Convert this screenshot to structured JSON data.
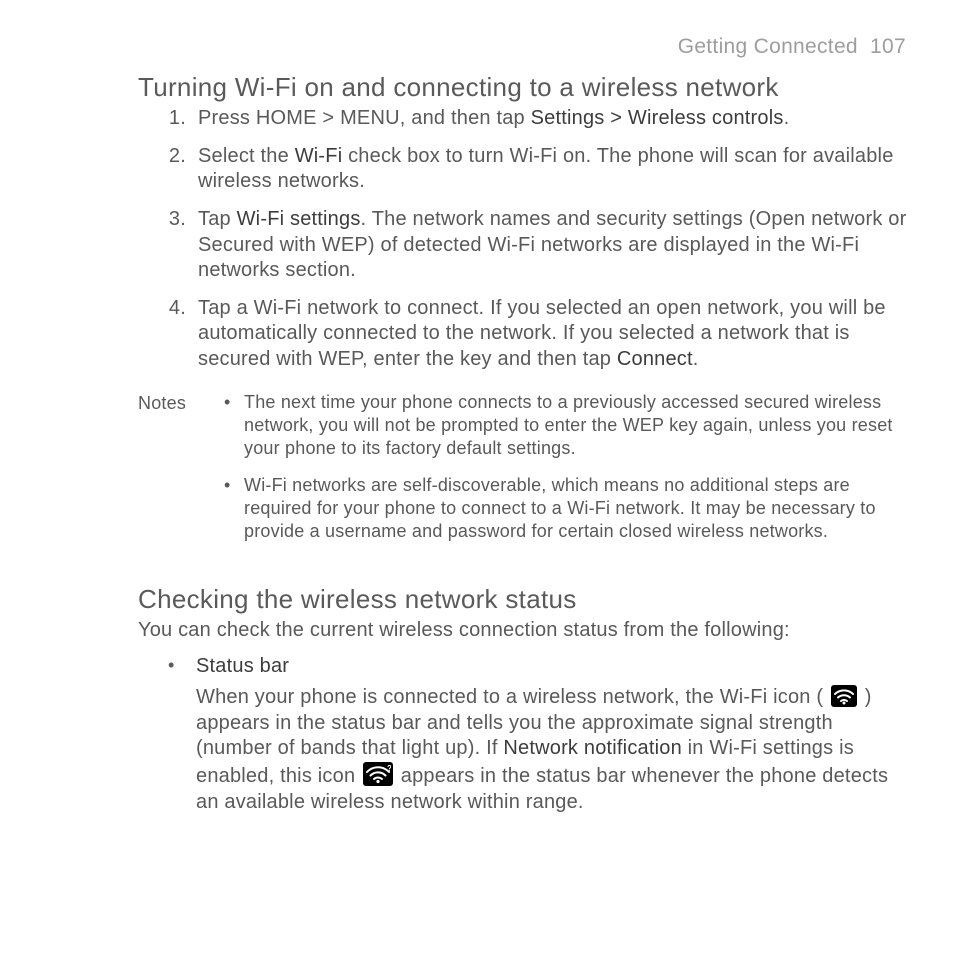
{
  "header": {
    "section": "Getting Connected",
    "page": "107"
  },
  "h_turn": "Turning Wi-Fi on and connecting to a wireless network",
  "steps": {
    "n1": "1.",
    "s1a": "Press HOME > MENU, and then tap ",
    "s1b": "Settings > Wireless controls",
    "s1c": ".",
    "n2": "2.",
    "s2a": "Select the ",
    "s2b": "Wi-Fi",
    "s2c": " check box to turn Wi-Fi on. The phone will scan for available wireless networks.",
    "n3": "3.",
    "s3a": "Tap ",
    "s3b": "Wi-Fi settings",
    "s3c": ". The network names and security settings (Open network or Secured with WEP) of detected Wi-Fi networks are displayed in the Wi-Fi networks section.",
    "n4": "4.",
    "s4a": "Tap a Wi-Fi network to connect. If you selected an open network, you will be automatically connected to the network. If you selected a network that is secured with WEP, enter the key and then tap ",
    "s4b": "Connect",
    "s4c": "."
  },
  "notes_label": "Notes",
  "notes": {
    "n1": "The next time your phone connects to a previously accessed secured wireless network, you will not be prompted to enter the WEP key again, unless you reset your phone to its factory default settings.",
    "n2": "Wi-Fi networks are self-discoverable, which means no additional steps are required for your phone to connect to a Wi-Fi network. It may be necessary to provide a username and password for certain closed wireless networks."
  },
  "h_check": "Checking the wireless network status",
  "check_intro": "You can check the current wireless connection status from the following:",
  "status": {
    "title": "Status bar",
    "p1a": "When your phone is connected to a wireless network, the Wi-Fi icon ( ",
    "p1b": " ) appears in the status bar and tells you the approximate signal strength (number of bands that light up). If ",
    "p1c": "Network notification",
    "p1d": " in Wi-Fi settings is enabled, this icon ",
    "p1e": " appears in the status bar whenever the phone detects an available wireless network within range."
  }
}
